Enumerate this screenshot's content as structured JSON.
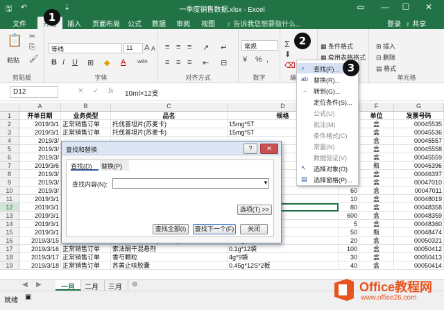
{
  "window": {
    "title": "一季度销售数据.xlsx - Excel",
    "controls": [
      "▭",
      "—",
      "☐",
      "✕"
    ]
  },
  "tabs": [
    "文件",
    "开始",
    "插入",
    "页面布局",
    "公式",
    "数据",
    "审阅",
    "视图"
  ],
  "tell_me": "♀ 告诉我您想要做什么...",
  "login": "登录",
  "share": "♀ 共享",
  "ribbon": {
    "clipboard": {
      "paste": "粘贴",
      "label": "剪贴板"
    },
    "font": {
      "name": "等线",
      "size": "11",
      "grow": "A",
      "shrink": "A",
      "bold": "B",
      "italic": "I",
      "underline": "U",
      "label": "字体",
      "phonetic": "wén"
    },
    "align": {
      "label": "对齐方式"
    },
    "number": {
      "format": "常规",
      "label": "数字",
      "percent": "%"
    },
    "styles": {
      "conditional": "条件格式",
      "table": "套用表格格式"
    },
    "cells": {
      "insert": "插入",
      "delete": "删除",
      "format": "格式",
      "label": "单元格"
    },
    "editing": {
      "label": "编"
    }
  },
  "formula_bar": {
    "name_box": "D12",
    "formula": "10ml×12支"
  },
  "columns": [
    "A",
    "B",
    "C",
    "D",
    "E",
    "F",
    "G"
  ],
  "header_row": [
    "开单日期",
    "业务类型",
    "品名",
    "规格",
    "",
    "单位",
    "发票号码"
  ],
  "rows": [
    {
      "n": "2",
      "a": "2019/3/1",
      "b": "正常销售订单",
      "c": "托伐普坦片(苏麦卡)",
      "d": "15mg*5T",
      "e": "",
      "f": "盒",
      "g": "00045535"
    },
    {
      "n": "3",
      "a": "2019/3/1",
      "b": "正常销售订单",
      "c": "托伐普坦片(苏麦卡)",
      "d": "15mg*5T",
      "e": "",
      "f": "盒",
      "g": "00045536"
    },
    {
      "n": "4",
      "a": "2019/3/",
      "b": "",
      "c": "",
      "d": "",
      "e": "",
      "f": "盒",
      "g": "00045557"
    },
    {
      "n": "5",
      "a": "2019/3/",
      "b": "",
      "c": "",
      "d": "",
      "e": "",
      "f": "盒",
      "g": "00045558"
    },
    {
      "n": "6",
      "a": "2019/3/",
      "b": "",
      "c": "",
      "d": "",
      "e": "",
      "f": "盒",
      "g": "00045559"
    },
    {
      "n": "7",
      "a": "2019/3/6",
      "b": "",
      "c": "",
      "d": "",
      "e": "",
      "f": "瓶",
      "g": "00046396"
    },
    {
      "n": "8",
      "a": "2019/3/",
      "b": "",
      "c": "",
      "d": "",
      "e": "",
      "f": "盒",
      "g": "00046397"
    },
    {
      "n": "9",
      "a": "2019/3/",
      "b": "",
      "c": "",
      "d": "",
      "e": "200",
      "f": "盒",
      "g": "00047010"
    },
    {
      "n": "10",
      "a": "2019/3/",
      "b": "",
      "c": "",
      "d": "",
      "e": "60",
      "f": "盒",
      "g": "00047011"
    },
    {
      "n": "11",
      "a": "2019/3/1",
      "b": "",
      "c": "",
      "d": "",
      "e": "10",
      "f": "盒",
      "g": "00048019"
    },
    {
      "n": "12",
      "a": "2019/3/1",
      "b": "",
      "c": "",
      "d": "",
      "e": "80",
      "f": "盒",
      "g": "00048358"
    },
    {
      "n": "13",
      "a": "2019/3/1",
      "b": "",
      "c": "",
      "d": "",
      "e": "600",
      "f": "盒",
      "g": "00048359"
    },
    {
      "n": "14",
      "a": "2019/3/1",
      "b": "",
      "c": "",
      "d": "",
      "e": "5",
      "f": "盒",
      "g": "00048360"
    },
    {
      "n": "15",
      "a": "2019/3/1",
      "b": "",
      "c": "",
      "d": "",
      "e": "50",
      "f": "瓶",
      "g": "00048474"
    },
    {
      "n": "16",
      "a": "2019/3/15",
      "b": "正常销售订单",
      "c": "达比加群酯胶囊(泰毕全)",
      "d": "0.15g*10S",
      "e": "20",
      "f": "盒",
      "g": "00050321"
    },
    {
      "n": "17",
      "a": "2019/3/16",
      "b": "正常销售订单",
      "c": "索法酮干混悬剂",
      "d": "0.1g*12袋",
      "e": "100",
      "f": "盒",
      "g": "00050412"
    },
    {
      "n": "18",
      "a": "2019/3/17",
      "b": "正常销售订单",
      "c": "香芍颗粒",
      "d": "4g*9袋",
      "e": "30",
      "f": "盒",
      "g": "00050413"
    },
    {
      "n": "19",
      "a": "2019/3/18",
      "b": "正常销售订单",
      "c": "苏黄止咳胶囊",
      "d": "0.45g*12S*2板",
      "e": "40",
      "f": "盒",
      "g": "00050414"
    }
  ],
  "sheets": [
    "一月",
    "二月",
    "三月"
  ],
  "status_text": "就绪",
  "dialog": {
    "title": "查找和替换",
    "help": "?",
    "close": "✕",
    "tab_find": "查找(D)",
    "tab_replace": "替换(P)",
    "find_label": "查找内容(N):",
    "find_value": "",
    "options": "选项(T) >>",
    "find_all": "查找全部(I)",
    "find_next": "查找下一个(F)",
    "close_btn": "关闭"
  },
  "menu": {
    "items": [
      {
        "icon": "⌕",
        "label": "查找(F)...",
        "gray": false
      },
      {
        "icon": "ab",
        "label": "替换(R)...",
        "gray": false
      },
      {
        "icon": "→",
        "label": "转到(G)...",
        "gray": false
      },
      {
        "icon": "",
        "label": "定位条件(S)...",
        "gray": false
      },
      {
        "icon": "",
        "label": "公式(U)",
        "gray": true
      },
      {
        "icon": "",
        "label": "批注(M)",
        "gray": true
      },
      {
        "icon": "",
        "label": "条件格式(C)",
        "gray": true
      },
      {
        "icon": "",
        "label": "常量(N)",
        "gray": true
      },
      {
        "icon": "",
        "label": "数据验证(V)",
        "gray": true
      },
      {
        "icon": "↖",
        "label": "选择对象(O)",
        "gray": false
      },
      {
        "icon": "▤",
        "label": "选择窗格(P)...",
        "gray": false
      }
    ]
  },
  "markers": [
    "1",
    "2",
    "3"
  ],
  "watermark": {
    "brand": "Office教程网",
    "url": "www.office26.com"
  },
  "colors": {
    "excel_green": "#217346",
    "accent_orange": "#e8541e"
  }
}
